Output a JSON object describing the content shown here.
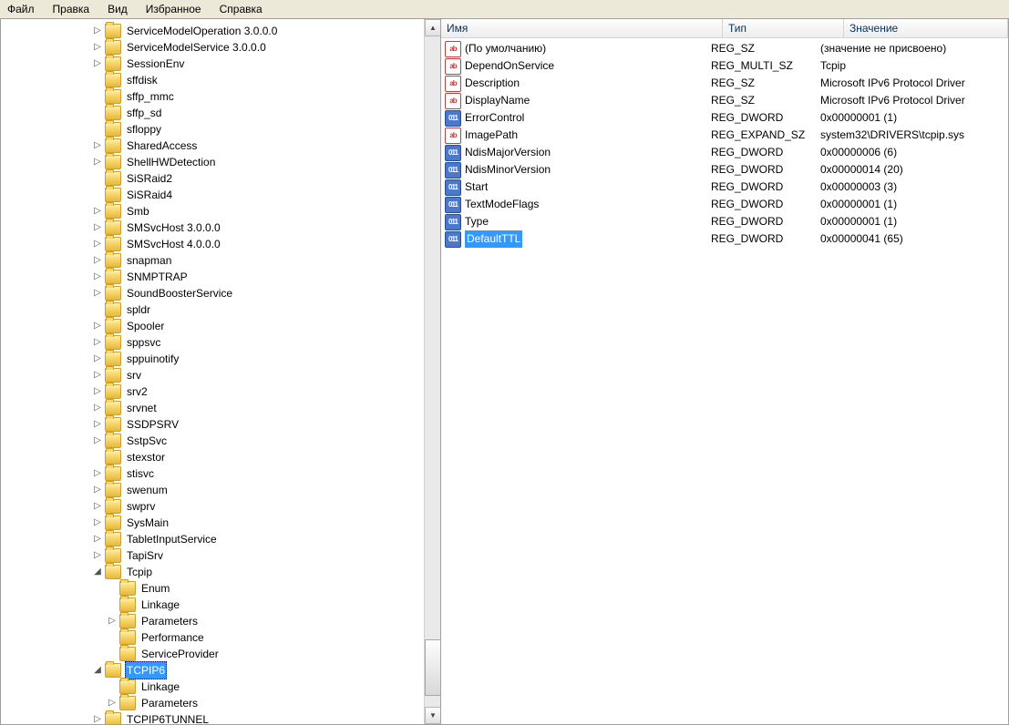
{
  "menu": {
    "file": "Файл",
    "edit": "Правка",
    "view": "Вид",
    "favorites": "Избранное",
    "help": "Справка"
  },
  "tree": {
    "items": [
      {
        "indent": 6,
        "exp": "closed",
        "label": "ServiceModelOperation 3.0.0.0"
      },
      {
        "indent": 6,
        "exp": "closed",
        "label": "ServiceModelService 3.0.0.0"
      },
      {
        "indent": 6,
        "exp": "closed",
        "label": "SessionEnv"
      },
      {
        "indent": 6,
        "exp": "none",
        "label": "sffdisk"
      },
      {
        "indent": 6,
        "exp": "none",
        "label": "sffp_mmc"
      },
      {
        "indent": 6,
        "exp": "none",
        "label": "sffp_sd"
      },
      {
        "indent": 6,
        "exp": "none",
        "label": "sfloppy"
      },
      {
        "indent": 6,
        "exp": "closed",
        "label": "SharedAccess"
      },
      {
        "indent": 6,
        "exp": "closed",
        "label": "ShellHWDetection"
      },
      {
        "indent": 6,
        "exp": "none",
        "label": "SiSRaid2"
      },
      {
        "indent": 6,
        "exp": "none",
        "label": "SiSRaid4"
      },
      {
        "indent": 6,
        "exp": "closed",
        "label": "Smb"
      },
      {
        "indent": 6,
        "exp": "closed",
        "label": "SMSvcHost 3.0.0.0"
      },
      {
        "indent": 6,
        "exp": "closed",
        "label": "SMSvcHost 4.0.0.0"
      },
      {
        "indent": 6,
        "exp": "closed",
        "label": "snapman"
      },
      {
        "indent": 6,
        "exp": "closed",
        "label": "SNMPTRAP"
      },
      {
        "indent": 6,
        "exp": "closed",
        "label": "SoundBoosterService"
      },
      {
        "indent": 6,
        "exp": "none",
        "label": "spldr"
      },
      {
        "indent": 6,
        "exp": "closed",
        "label": "Spooler"
      },
      {
        "indent": 6,
        "exp": "closed",
        "label": "sppsvc"
      },
      {
        "indent": 6,
        "exp": "closed",
        "label": "sppuinotify"
      },
      {
        "indent": 6,
        "exp": "closed",
        "label": "srv"
      },
      {
        "indent": 6,
        "exp": "closed",
        "label": "srv2"
      },
      {
        "indent": 6,
        "exp": "closed",
        "label": "srvnet"
      },
      {
        "indent": 6,
        "exp": "closed",
        "label": "SSDPSRV"
      },
      {
        "indent": 6,
        "exp": "closed",
        "label": "SstpSvc"
      },
      {
        "indent": 6,
        "exp": "none",
        "label": "stexstor"
      },
      {
        "indent": 6,
        "exp": "closed",
        "label": "stisvc"
      },
      {
        "indent": 6,
        "exp": "closed",
        "label": "swenum"
      },
      {
        "indent": 6,
        "exp": "closed",
        "label": "swprv"
      },
      {
        "indent": 6,
        "exp": "closed",
        "label": "SysMain"
      },
      {
        "indent": 6,
        "exp": "closed",
        "label": "TabletInputService"
      },
      {
        "indent": 6,
        "exp": "closed",
        "label": "TapiSrv"
      },
      {
        "indent": 6,
        "exp": "open",
        "label": "Tcpip"
      },
      {
        "indent": 7,
        "exp": "none",
        "label": "Enum"
      },
      {
        "indent": 7,
        "exp": "none",
        "label": "Linkage"
      },
      {
        "indent": 7,
        "exp": "closed",
        "label": "Parameters"
      },
      {
        "indent": 7,
        "exp": "none",
        "label": "Performance"
      },
      {
        "indent": 7,
        "exp": "none",
        "label": "ServiceProvider"
      },
      {
        "indent": 6,
        "exp": "open",
        "label": "TCPIP6",
        "selected": true
      },
      {
        "indent": 7,
        "exp": "none",
        "label": "Linkage"
      },
      {
        "indent": 7,
        "exp": "closed",
        "label": "Parameters"
      },
      {
        "indent": 6,
        "exp": "closed",
        "label": "TCPIP6TUNNEL"
      }
    ]
  },
  "list": {
    "columns": {
      "name": "Имя",
      "type": "Тип",
      "value": "Значение"
    },
    "rows": [
      {
        "icon": "str",
        "name": "(По умолчанию)",
        "type": "REG_SZ",
        "value": "(значение не присвоено)"
      },
      {
        "icon": "str",
        "name": "DependOnService",
        "type": "REG_MULTI_SZ",
        "value": "Tcpip"
      },
      {
        "icon": "str",
        "name": "Description",
        "type": "REG_SZ",
        "value": "Microsoft IPv6 Protocol Driver"
      },
      {
        "icon": "str",
        "name": "DisplayName",
        "type": "REG_SZ",
        "value": "Microsoft IPv6 Protocol Driver"
      },
      {
        "icon": "reg",
        "name": "ErrorControl",
        "type": "REG_DWORD",
        "value": "0x00000001 (1)"
      },
      {
        "icon": "str",
        "name": "ImagePath",
        "type": "REG_EXPAND_SZ",
        "value": "system32\\DRIVERS\\tcpip.sys"
      },
      {
        "icon": "reg",
        "name": "NdisMajorVersion",
        "type": "REG_DWORD",
        "value": "0x00000006 (6)"
      },
      {
        "icon": "reg",
        "name": "NdisMinorVersion",
        "type": "REG_DWORD",
        "value": "0x00000014 (20)"
      },
      {
        "icon": "reg",
        "name": "Start",
        "type": "REG_DWORD",
        "value": "0x00000003 (3)"
      },
      {
        "icon": "reg",
        "name": "TextModeFlags",
        "type": "REG_DWORD",
        "value": "0x00000001 (1)"
      },
      {
        "icon": "reg",
        "name": "Type",
        "type": "REG_DWORD",
        "value": "0x00000001 (1)"
      },
      {
        "icon": "reg",
        "name": "DefaultTTL",
        "type": "REG_DWORD",
        "value": "0x00000041 (65)",
        "selected": true
      }
    ]
  }
}
